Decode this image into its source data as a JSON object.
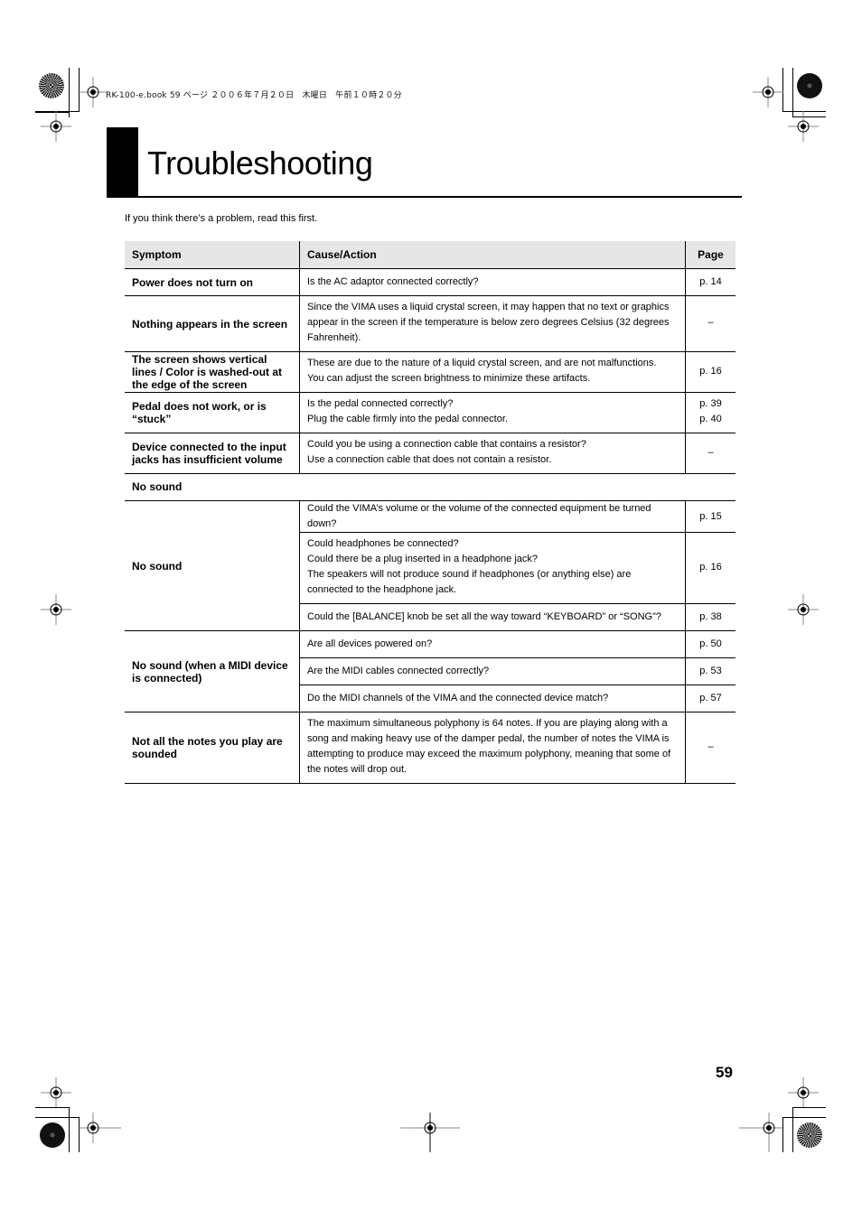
{
  "print_header": "RK-100-e.book  59 ページ  ２００６年７月２０日　木曜日　午前１０時２０分",
  "title": "Troubleshooting",
  "intro": "If you think there’s a problem, read this first.",
  "table": {
    "headers": {
      "symptom": "Symptom",
      "cause": "Cause/Action",
      "page": "Page"
    },
    "rows": [
      {
        "symptom": "Power does not turn on",
        "causes": [
          {
            "lines": [
              "Is the AC adaptor connected correctly?"
            ],
            "page": "p. 14"
          }
        ]
      },
      {
        "symptom": "Nothing appears in the screen",
        "causes": [
          {
            "lines": [
              "Since the VIMA uses a liquid crystal screen, it may happen that no text or graphics appear in the screen if the temperature is below zero degrees Celsius (32 degrees Fahrenheit)."
            ],
            "page": "–"
          }
        ]
      },
      {
        "symptom": "The screen shows vertical lines / Color is washed-out at the edge of the screen",
        "causes": [
          {
            "lines": [
              "These are due to the nature of a liquid crystal screen, and are not malfunctions.",
              "You can adjust the screen brightness to minimize these artifacts."
            ],
            "page": "p. 16"
          }
        ]
      },
      {
        "symptom": "Pedal does not work, or is “stuck”",
        "causes": [
          {
            "lines": [
              "Is the pedal connected correctly?",
              "Plug the cable firmly into the pedal connector."
            ],
            "pages": [
              "p. 39",
              "p. 40"
            ]
          }
        ]
      },
      {
        "symptom": "Device connected to the input jacks has insufficient volume",
        "causes": [
          {
            "lines": [
              "Could you be using a connection cable that contains a resistor?",
              "Use a connection cable that does not contain a resistor."
            ],
            "page": "–"
          }
        ]
      }
    ],
    "section": "No sound",
    "section_rows": [
      {
        "symptom": "No sound",
        "causes": [
          {
            "lines": [
              "Could the VIMA’s volume or the volume of the connected equipment be turned down?"
            ],
            "page": "p. 15"
          },
          {
            "lines": [
              "Could headphones be connected?",
              "Could there be a plug inserted in a headphone jack?",
              "The speakers will not produce sound if headphones (or anything else) are connected to the headphone jack."
            ],
            "page": "p. 16"
          },
          {
            "lines": [
              "Could the [BALANCE] knob be set all the way toward “KEYBOARD” or “SONG”?"
            ],
            "page": "p. 38"
          }
        ]
      },
      {
        "symptom": "No sound (when a MIDI device is connected)",
        "causes": [
          {
            "lines": [
              "Are all devices powered on?"
            ],
            "page": "p. 50"
          },
          {
            "lines": [
              "Are the MIDI cables connected correctly?"
            ],
            "page": "p. 53"
          },
          {
            "lines": [
              "Do the MIDI channels of the VIMA and the connected device match?"
            ],
            "page": "p. 57"
          }
        ]
      },
      {
        "symptom": "Not all the notes you play are sounded",
        "causes": [
          {
            "lines": [
              "The maximum simultaneous polyphony is 64 notes. If you are playing along with a song and making heavy use of the damper pedal, the number of notes the VIMA is attempting to produce may exceed the maximum polyphony, meaning that some of the notes will drop out."
            ],
            "page": "–"
          }
        ]
      }
    ]
  },
  "page_number": "59"
}
